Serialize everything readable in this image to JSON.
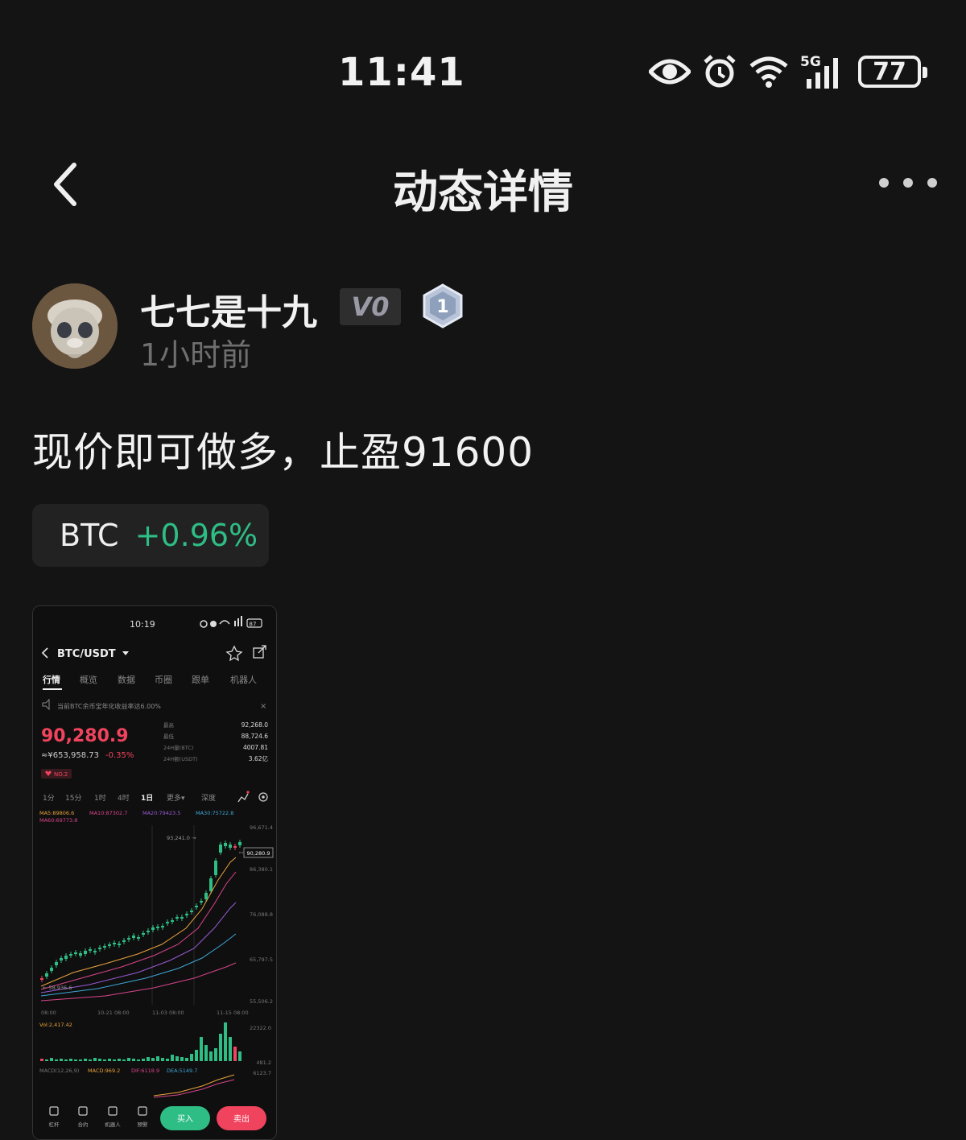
{
  "status_bar": {
    "time": "11:41",
    "network": "5G",
    "battery": "77"
  },
  "header": {
    "title": "动态详情",
    "back_icon": "chevron-left-icon",
    "more_icon": "more-horizontal-icon"
  },
  "author": {
    "name": "七七是十九",
    "level": "V0",
    "rank": "1",
    "time_ago": "1小时前"
  },
  "post": {
    "text": "现价即可做多，止盈91600",
    "coin": {
      "symbol": "BTC",
      "change": "+0.96%"
    }
  },
  "attachment": {
    "time": "10:19",
    "battery": "87",
    "pair": "BTC/USDT",
    "tabs": [
      "行情",
      "概览",
      "数据",
      "币圈",
      "跟单",
      "机器人"
    ],
    "notice": "当前BTC余币宝年化收益率达6.00%",
    "price": "90,280.9",
    "cny_price": "≈¥653,958.73",
    "change": "-0.35%",
    "rank_tag": "NO.2",
    "stats": [
      {
        "label": "最高",
        "value": "92,268.0"
      },
      {
        "label": "最低",
        "value": "88,724.6"
      },
      {
        "label": "24H量(BTC)",
        "value": "4007.81"
      },
      {
        "label": "24H额(USDT)",
        "value": "3.62亿"
      }
    ],
    "intervals": [
      "1分",
      "15分",
      "1时",
      "4时",
      "1日",
      "更多▾",
      "深度"
    ],
    "ma_line1": [
      "MA5:89806.6",
      "MA10:87302.7",
      "MA20:79423.5",
      "MA30:75722.8"
    ],
    "ma_line2": "MA60:69773.8",
    "y_ticks": [
      "96,671.4",
      "86,380.1",
      "76,088.8",
      "65,797.5",
      "55,506.2"
    ],
    "high_label": "93,241.0",
    "price_tag": "90,280.9",
    "low_label": "58,936.6",
    "x_ticks": [
      "08:00",
      "10-21 08:00",
      "11-03 08:00",
      "11-15 08:00"
    ],
    "volume_label": "Vol:2,417.42",
    "volume_ticks": [
      "22322.0",
      "481.2"
    ],
    "macd_labels": [
      "MACD(12,26,9)",
      "MACD:969.2",
      "DIF:6118.9",
      "DEA:5149.7"
    ],
    "macd_tick": "6123.7",
    "bottom_nav": [
      "杠杆",
      "合约",
      "机器人",
      "预警"
    ],
    "buy_label": "买入",
    "sell_label": "卖出",
    "colors": {
      "up": "#2ebd85",
      "down": "#f0435d"
    }
  }
}
